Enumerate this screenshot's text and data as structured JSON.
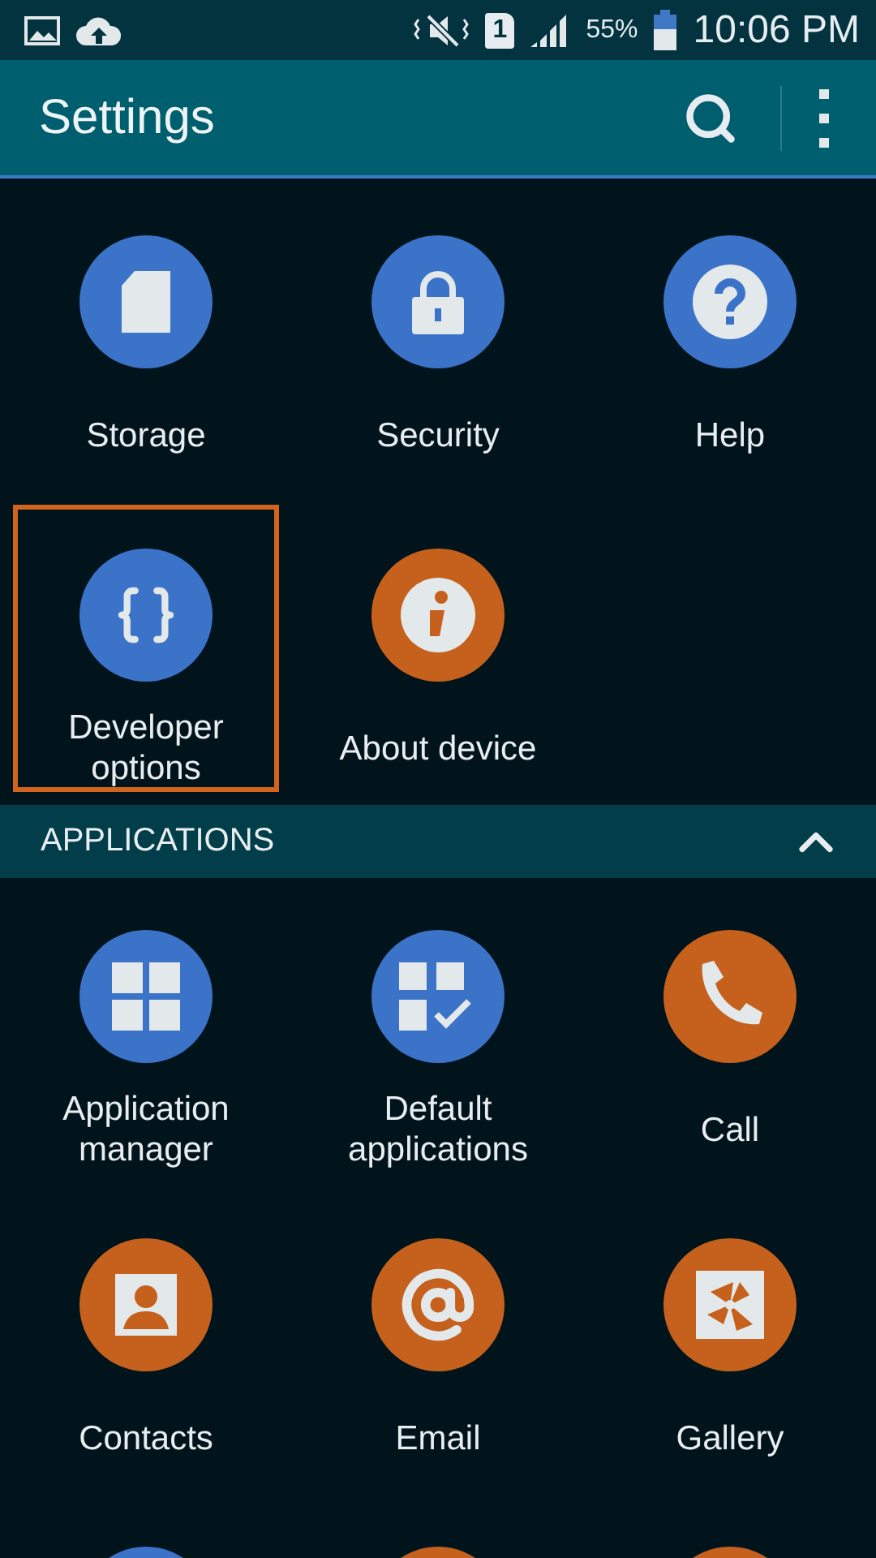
{
  "status_bar": {
    "sim": "1",
    "battery_text": "55%",
    "time": "10:06 PM"
  },
  "toolbar": {
    "title": "Settings"
  },
  "sections": [
    {
      "items": [
        {
          "label": "Storage",
          "color": "#3b73c8",
          "selected": false
        },
        {
          "label": "Security",
          "color": "#3b73c8",
          "selected": false
        },
        {
          "label": "Help",
          "color": "#3b73c8",
          "selected": false
        },
        {
          "label": "Developer options",
          "color": "#3b73c8",
          "selected": true
        },
        {
          "label": "About device",
          "color": "#c5611c",
          "selected": false
        }
      ]
    },
    {
      "header": "APPLICATIONS",
      "expanded": true,
      "items": [
        {
          "label": "Application manager",
          "color": "#3b73c8",
          "selected": false
        },
        {
          "label": "Default applications",
          "color": "#3b73c8",
          "selected": false
        },
        {
          "label": "Call",
          "color": "#c5611c",
          "selected": false
        },
        {
          "label": "Contacts",
          "color": "#c5611c",
          "selected": false
        },
        {
          "label": "Email",
          "color": "#c5611c",
          "selected": false
        },
        {
          "label": "Gallery",
          "color": "#c5611c",
          "selected": false
        },
        {
          "color": "#3b73c8",
          "selected": false
        },
        {
          "color": "#c5611c",
          "selected": false
        },
        {
          "color": "#c5611c",
          "selected": false
        }
      ]
    }
  ]
}
